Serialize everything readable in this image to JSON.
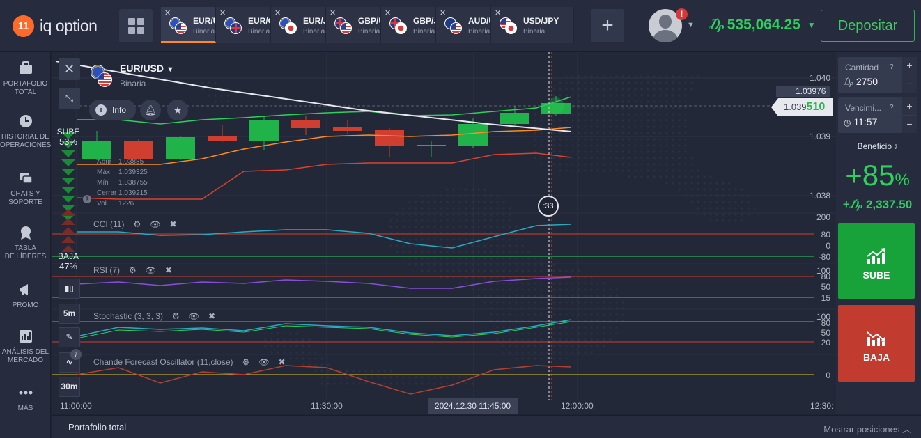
{
  "brand": {
    "badge": "11",
    "name": "iq option"
  },
  "tabs": [
    {
      "symbol": "EUR/U",
      "type": "Binaria",
      "flags": [
        "eu",
        "us"
      ]
    },
    {
      "symbol": "EUR/G",
      "type": "Binaria",
      "flags": [
        "eu",
        "gb"
      ]
    },
    {
      "symbol": "EUR/J",
      "type": "Binaria",
      "flags": [
        "eu",
        "jp"
      ]
    },
    {
      "symbol": "GBP/U",
      "type": "Binaria",
      "flags": [
        "gb",
        "us"
      ]
    },
    {
      "symbol": "GBP/J",
      "type": "Binaria",
      "flags": [
        "gb",
        "jp"
      ]
    },
    {
      "symbol": "AUD/U",
      "type": "Binaria",
      "flags": [
        "au",
        "us"
      ]
    },
    {
      "symbol": "USD/JPY",
      "type": "Binaria",
      "flags": [
        "us",
        "jp"
      ]
    }
  ],
  "account": {
    "alert": "!",
    "currency_icon": "₯",
    "balance": "535,064.25",
    "deposit_label": "Depositar"
  },
  "sidebar": [
    {
      "label": "PORTAFOLIO\nTOTAL",
      "icon": "briefcase-icon"
    },
    {
      "label": "HISTORIAL DE\nOPERACIONES",
      "icon": "clock-icon"
    },
    {
      "label": "CHATS Y\nSOPORTE",
      "icon": "chat-icon"
    },
    {
      "label": "TABLA\nDE LÍDERES",
      "icon": "medal-icon"
    },
    {
      "label": "PROMO",
      "icon": "megaphone-icon"
    },
    {
      "label": "ANÁLISIS DEL\nMERCADO",
      "icon": "analytics-icon"
    },
    {
      "label": "MÁS",
      "icon": "more-icon"
    }
  ],
  "asset": {
    "name": "EUR/USD",
    "type": "Binaria",
    "info_label": "Info"
  },
  "ohlc": [
    {
      "k": "Abrir",
      "v": "1.03885"
    },
    {
      "k": "Máx",
      "v": "1.039325"
    },
    {
      "k": "Mín",
      "v": "1.038755"
    },
    {
      "k": "Cerrar",
      "v": "1.039215"
    },
    {
      "k": "Vol.",
      "v": "1226"
    }
  ],
  "sentiment": {
    "up_label": "SUBE",
    "up_pct": "53%",
    "down_label": "BAJA",
    "down_pct": "47%"
  },
  "tools": {
    "timeframe": "5m",
    "expiry": "30m",
    "indicator_count": "7"
  },
  "indicators": [
    {
      "label": "CCI (11)"
    },
    {
      "label": "RSI (7)"
    },
    {
      "label": "Stochastic (3, 3, 3)"
    },
    {
      "label": "Chande Forecast Oscillator (11,close)"
    }
  ],
  "price_axis": {
    "p1": "1.040",
    "p2": "1.039",
    "p3": "1.038",
    "marked": "1.03976",
    "current_prefix": "1.039",
    "current_suffix": "510"
  },
  "cci_axis": [
    "200",
    "80",
    "0",
    "-80"
  ],
  "rsi_axis": [
    "100",
    "80",
    "50",
    "15"
  ],
  "stoch_axis": [
    "100",
    "80",
    "50",
    "20"
  ],
  "cfo_axis": [
    "0"
  ],
  "timer": ":33",
  "time_axis": {
    "t1": "11:00:00",
    "t2": "11:30:00",
    "t3": "12:00:00",
    "t4": "12:30:",
    "cursor": "2024.12.30 11:45:00"
  },
  "trade": {
    "amount_label": "Cantidad",
    "amount_icon": "₯",
    "amount": "2750",
    "expiry_label": "Vencimi...",
    "expiry": "11:57",
    "profit_label": "Beneficio",
    "profit_pct": "+85",
    "profit_pct_sign": "%",
    "profit_amt": "2,337.50",
    "call_label": "SUBE",
    "put_label": "BAJA"
  },
  "bottom": {
    "title": "Portafolio total",
    "right": "Mostrar posiciones"
  },
  "colors": {
    "green": "#2ecf5c",
    "red": "#c23b2f",
    "accent": "#ff8a1e"
  }
}
